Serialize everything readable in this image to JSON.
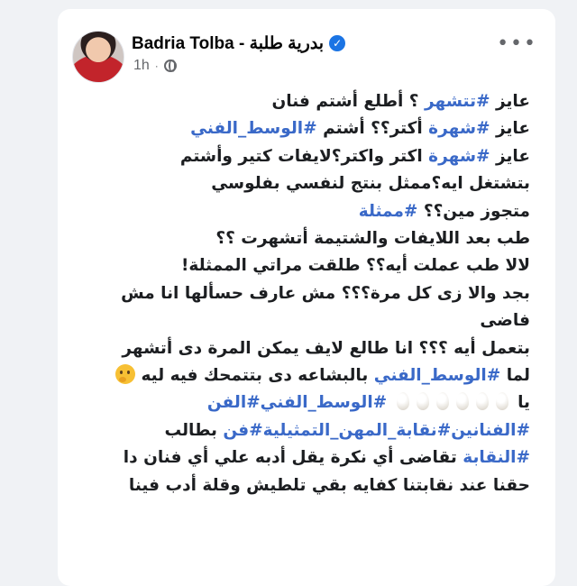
{
  "post": {
    "author": "Badria Tolba - بدرية طلبة",
    "time": "1h",
    "more": "•••"
  },
  "text": {
    "l1_a": "عايز ",
    "l1_tag": "#تتشهر",
    "l1_b": " ؟ أطلع أشتم فنان",
    "l2_a": "عايز ",
    "l2_tag1": "#شهرة",
    "l2_b": " أكتر؟؟ أشتم ",
    "l2_tag2": "#الوسط_الفني",
    "l3_a": "عايز ",
    "l3_tag": "#شهرة",
    "l3_b": " اكتر واكتر؟لايفات كتير وأشتم",
    "l4": "بتشتغل ايه؟ممثل بنتج لنفسي بفلوسي",
    "l5_a": "متجوز مين؟؟ ",
    "l5_tag": "#ممثلة",
    "l6": "طب بعد اللايفات والشتيمة أتشهرت ؟؟",
    "l7": "لالا طب عملت أيه؟؟ طلقت مراتي الممثلة!",
    "l8": "بجد والا زى كل مرة؟؟؟ مش عارف حسألها  انا مش",
    "l9": "فاضى",
    "l10": "بتعمل أيه ؟؟؟ انا طالع لايف يمكن المرة دى أتشهر",
    "l11_a": "لما ",
    "l11_tag": "#الوسط_الفني",
    "l11_b": " بالبشاعه دى بتتمحك فيه ليه",
    "l12_a": "يا",
    "l12_tag1": "#الوسط_الفني",
    "l12_tag2": "#الفن",
    "l13_tag1": "#الفنانين",
    "l13_tag2": "#نقابة_المهن_التمثيلية",
    "l13_tag3": "#فن",
    "l13_b": " بطالب",
    "l14_tag": "#النقابة",
    "l14_b": " تقاضى أي نكرة يقل أدبه علي أي فنان دا",
    "l15": "حقنا عند نقابتنا كفايه بقي تلطيش وقلة أدب فينا"
  }
}
